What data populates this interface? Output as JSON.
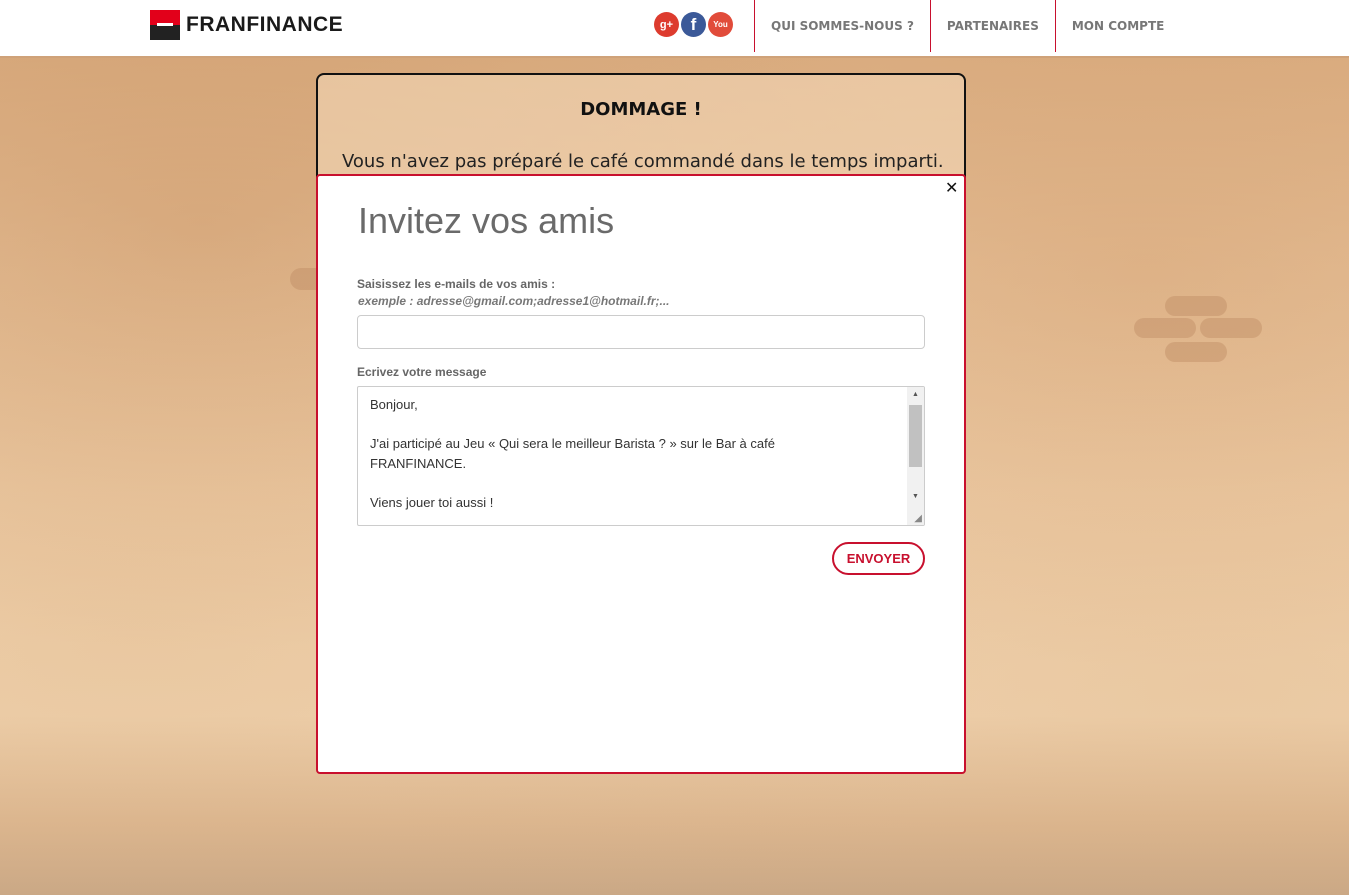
{
  "header": {
    "brand": "FRANFINANCE",
    "social": [
      {
        "icon": "google-plus-icon",
        "glyph": "g+"
      },
      {
        "icon": "facebook-icon",
        "glyph": "f"
      },
      {
        "icon": "youtube-icon",
        "glyph": "You"
      }
    ],
    "nav": [
      "QUI SOMMES-NOUS ?",
      "PARTENAIRES",
      "MON COMPTE"
    ]
  },
  "game": {
    "title": "DOMMAGE !",
    "message": "Vous n'avez pas préparé le café commandé dans le temps imparti."
  },
  "modal": {
    "title": "Invitez vos amis",
    "emails_label": "Saisissez les e-mails de vos amis :",
    "emails_example": "exemple : adresse@gmail.com;adresse1@hotmail.fr;...",
    "emails_value": "",
    "message_label": "Ecrivez votre message",
    "message_lines": [
      "Bonjour,",
      "",
      "J'ai participé au Jeu « Qui sera le meilleur Barista ? » sur le Bar à café",
      "FRANFINANCE.",
      "",
      "Viens jouer toi aussi !"
    ],
    "send_label": "ENVOYER",
    "close_glyph": "✕"
  },
  "colors": {
    "brand_red": "#c8102e",
    "background": "#e7c29a"
  }
}
